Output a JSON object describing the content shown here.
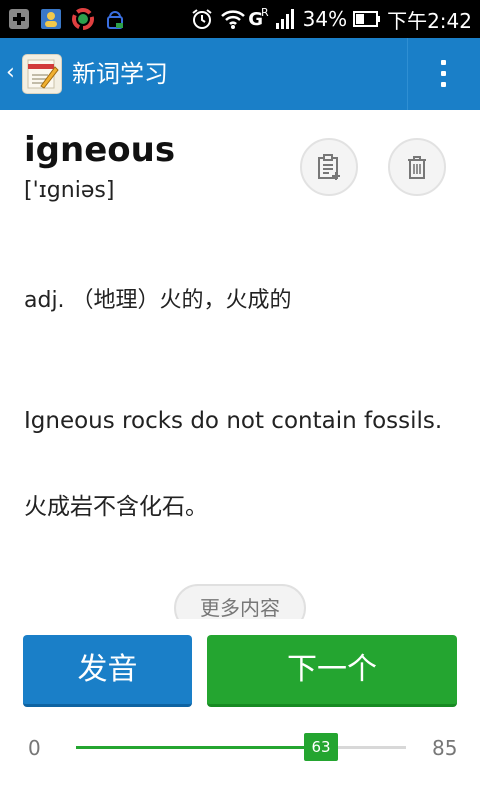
{
  "status_bar": {
    "battery": "34%",
    "time": "下午2:42",
    "network": "G",
    "roaming": "R"
  },
  "app_bar": {
    "title": "新词学习"
  },
  "word": {
    "headword": "igneous",
    "phonetic": "['ɪgniəs]",
    "definition": "adj. （地理）火的，火成的",
    "example_en": "Igneous rocks do not contain fossils.",
    "example_zh": "火成岩不含化石。"
  },
  "actions": {
    "more_label": "更多内容",
    "pronounce_label": "发音",
    "next_label": "下一个"
  },
  "progress": {
    "min": "0",
    "max": "85",
    "current": "63",
    "fraction": 0.741
  },
  "colors": {
    "accent_blue": "#1a7fc8",
    "accent_green": "#24a530"
  }
}
